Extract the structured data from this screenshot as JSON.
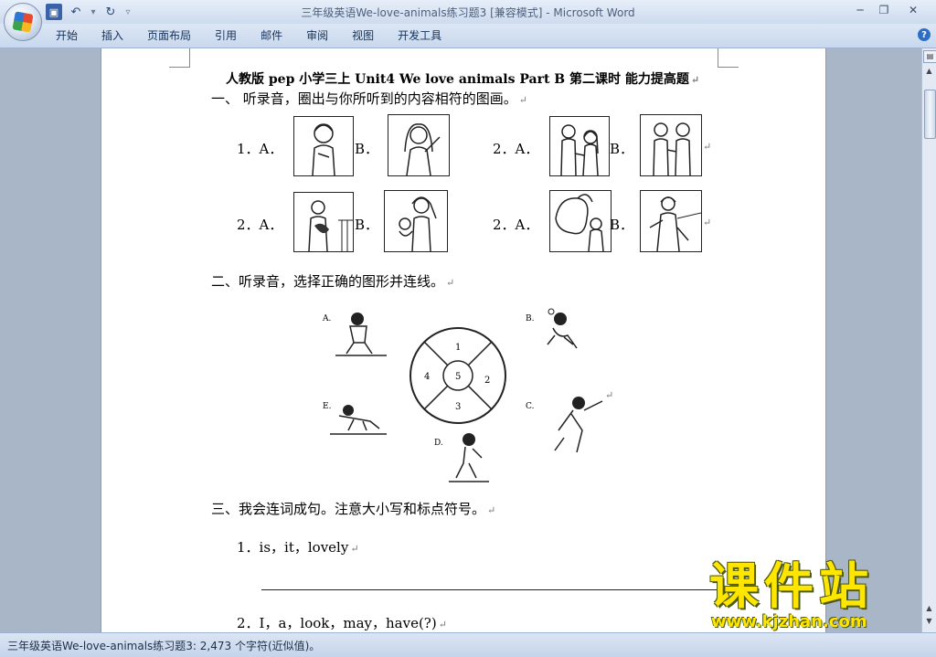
{
  "window": {
    "title": "三年级英语We-love-animals练习题3 [兼容模式] - Microsoft Word"
  },
  "quick_access": {
    "save_icon": "save-icon",
    "undo_icon": "undo-icon",
    "redo_icon": "redo-icon",
    "customize_icon": "customize-icon"
  },
  "menu": {
    "items": [
      "开始",
      "插入",
      "页面布局",
      "引用",
      "邮件",
      "审阅",
      "视图",
      "开发工具"
    ]
  },
  "document": {
    "title": "人教版 pep 小学三上 Unit4 We love animals Part B 第二课时  能力提高题",
    "section1": {
      "heading": "一、   听录音，圈出与你所听到的内容相符的图画。",
      "rows": [
        {
          "left_num": "1．A．",
          "left_b": "B．",
          "right_num": "2．A．",
          "right_b": "B．"
        },
        {
          "left_num": "2．A．",
          "left_b": "B．",
          "right_num": "2．A．",
          "right_b": "B．"
        }
      ]
    },
    "section2": {
      "heading": "二、听录音，选择正确的图形并连线。",
      "wheel": [
        "1",
        "2",
        "3",
        "4",
        "5"
      ],
      "options": [
        "A.",
        "B.",
        "C.",
        "D.",
        "E."
      ]
    },
    "section3": {
      "heading": "三、我会连词成句。注意大小写和标点符号。",
      "q1": "1．is，it，lovely",
      "q2": "2．I，a，look，may，have(?)"
    },
    "paragraph_mark": "↵"
  },
  "status": {
    "text": "三年级英语We-love-animals练习题3: 2,473 个字符(近似值)。"
  },
  "watermark": {
    "brand": "课件站",
    "url": "www.kjzhan.com"
  },
  "colors": {
    "accent": "#2d6fc6",
    "watermark": "#ffe600"
  }
}
